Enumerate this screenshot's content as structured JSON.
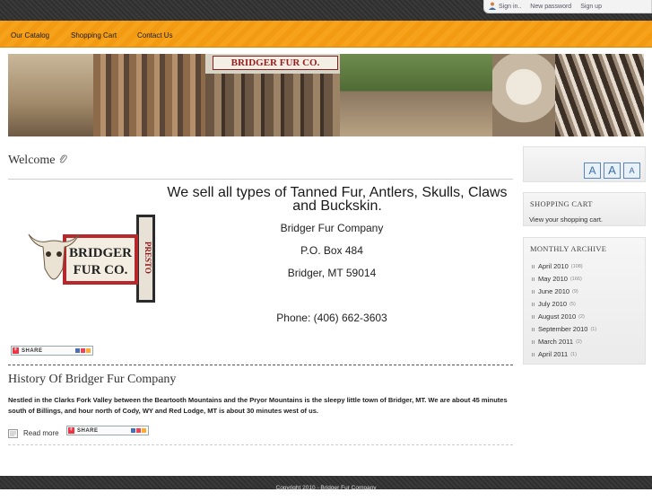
{
  "topbar": {
    "sign_in": "Sign in..",
    "new_password": "New password",
    "sign_up": "Sign up"
  },
  "nav": {
    "items": [
      "Our Catalog",
      "Shopping Cart",
      "Contact Us"
    ]
  },
  "banner": {
    "sign_text": "BRIDGER FUR CO."
  },
  "main": {
    "welcome_title": "Welcome",
    "tagline": "We sell all types of Tanned Fur, Antlers, Skulls, Claws and Buckskin.",
    "address": {
      "company": "Bridger Fur Company",
      "po_box": "P.O. Box 484",
      "city": "Bridger, MT 59014",
      "phone": "Phone: (406) 662-3603"
    },
    "logo_text": [
      "BRIDGER",
      "FUR CO."
    ],
    "logo_side_text": "PRESTO",
    "share_label": "SHARE",
    "history_title": "History Of Bridger Fur Company",
    "history_body": "Nestled in the Clarks Fork Valley between the Beartooth Mountains and the Pryor Mountains is the sleepy little town of Bridger, MT. We are about 45 minutes south of Billings, and hour north of Cody, WY and Red Lodge, MT is about 30 minutes west of us.",
    "read_more": "Read more"
  },
  "sidebar": {
    "font_sizes": [
      "A",
      "A",
      "A"
    ],
    "cart_heading": "SHOPPING CART",
    "cart_link": "View your shopping cart.",
    "archive_heading": "MONTHLY ARCHIVE",
    "archive": [
      {
        "label": "April 2010",
        "count": "(108)"
      },
      {
        "label": "May 2010",
        "count": "(166)"
      },
      {
        "label": "June 2010",
        "count": "(9)"
      },
      {
        "label": "July 2010",
        "count": "(5)"
      },
      {
        "label": "August 2010",
        "count": "(2)"
      },
      {
        "label": "September 2010",
        "count": "(1)"
      },
      {
        "label": "March 2011",
        "count": "(2)"
      },
      {
        "label": "April 2011",
        "count": "(1)"
      }
    ]
  },
  "footer": {
    "text": "Copyright 2010 - Bridger Fur Company"
  },
  "colors": {
    "nav_orange": "#f7a21b",
    "dark_bar": "#333333",
    "link_blue": "#3a6da3"
  }
}
